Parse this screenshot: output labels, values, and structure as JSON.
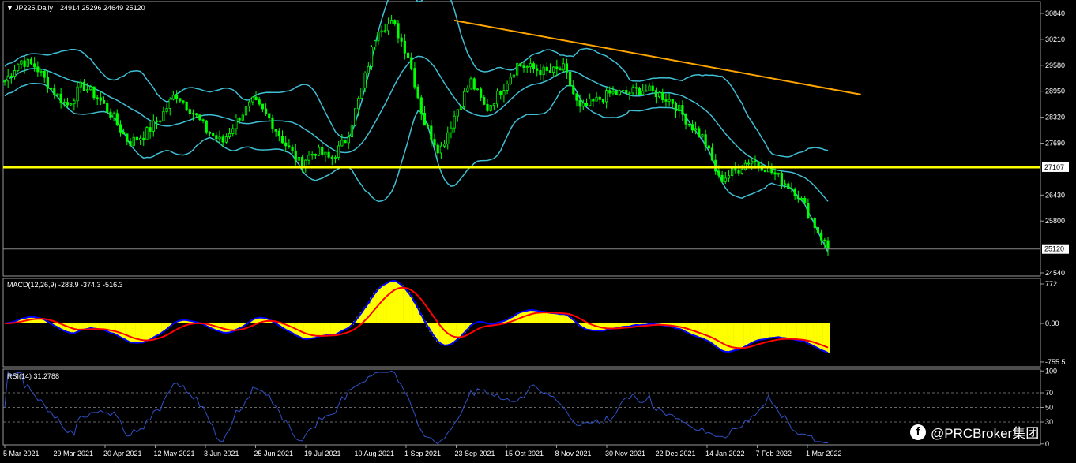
{
  "chart_data": [
    {
      "type": "line",
      "panel": "price",
      "title": "JP225,Daily",
      "ohlc_text": "24914 25296 24649 25120",
      "ylim": [
        24540,
        31000
      ],
      "y_ticks": [
        "30840",
        "30210",
        "29580",
        "28950",
        "28320",
        "27690",
        "27107",
        "26430",
        "25800",
        "25120",
        "24540"
      ],
      "support_level": {
        "value": 27107,
        "label": "27107",
        "color": "#ffff00"
      },
      "last_price": {
        "value": 25120,
        "label": "25120"
      },
      "trendline": {
        "from": [
          0.546,
          30670
        ],
        "to": [
          1.04,
          28870
        ],
        "color": "#ffa500"
      },
      "series": [
        {
          "name": "close",
          "color": "#00ff00",
          "values": [
            29200,
            29700,
            29550,
            29000,
            28600,
            29100,
            28800,
            28300,
            27700,
            27900,
            28300,
            28900,
            28500,
            28000,
            27700,
            28300,
            28700,
            28300,
            27700,
            27200,
            27500,
            27300,
            27800,
            29000,
            30500,
            30600,
            29800,
            28200,
            27500,
            28400,
            29200,
            28500,
            29000,
            29600,
            29500,
            29400,
            29500,
            28500,
            28700,
            28900,
            28900,
            29000,
            28900,
            28700,
            28200,
            27800,
            26800,
            27000,
            27300,
            27100,
            26800,
            26500,
            25800,
            25120
          ]
        }
      ],
      "x_labels": [
        "5 Mar 2021",
        "29 Mar 2021",
        "20 Apr 2021",
        "12 May 2021",
        "3 Jun 2021",
        "25 Jun 2021",
        "19 Jul 2021",
        "10 Aug 2021",
        "1 Sep 2021",
        "23 Sep 2021",
        "15 Oct 2021",
        "8 Nov 2021",
        "30 Nov 2021",
        "22 Dec 2021",
        "14 Jan 2022",
        "7 Feb 2022",
        "1 Mar 2022"
      ]
    },
    {
      "type": "bar",
      "panel": "macd",
      "title": "MACD(12,26,9) -283.9 -374.3 -516.3",
      "ylim": [
        -1000,
        850
      ],
      "y_ticks": [
        "772",
        "0.00",
        "-755.5"
      ]
    },
    {
      "type": "line",
      "panel": "rsi",
      "title": "RSI(14) 31.2788",
      "ylim": [
        0,
        100
      ],
      "y_ticks": [
        "100",
        "70",
        "50",
        "30",
        "0"
      ]
    }
  ],
  "watermark": {
    "brand": "@PRCBroker集团"
  },
  "colors": {
    "candles": "#00ff00",
    "bands": "#3fbfd4",
    "support": "#ffff00",
    "trend": "#ffa500",
    "macd_hist": "#ffff00",
    "macd_line": "#0000ff",
    "signal_line": "#ff0000",
    "rsi": "#3050c8"
  }
}
